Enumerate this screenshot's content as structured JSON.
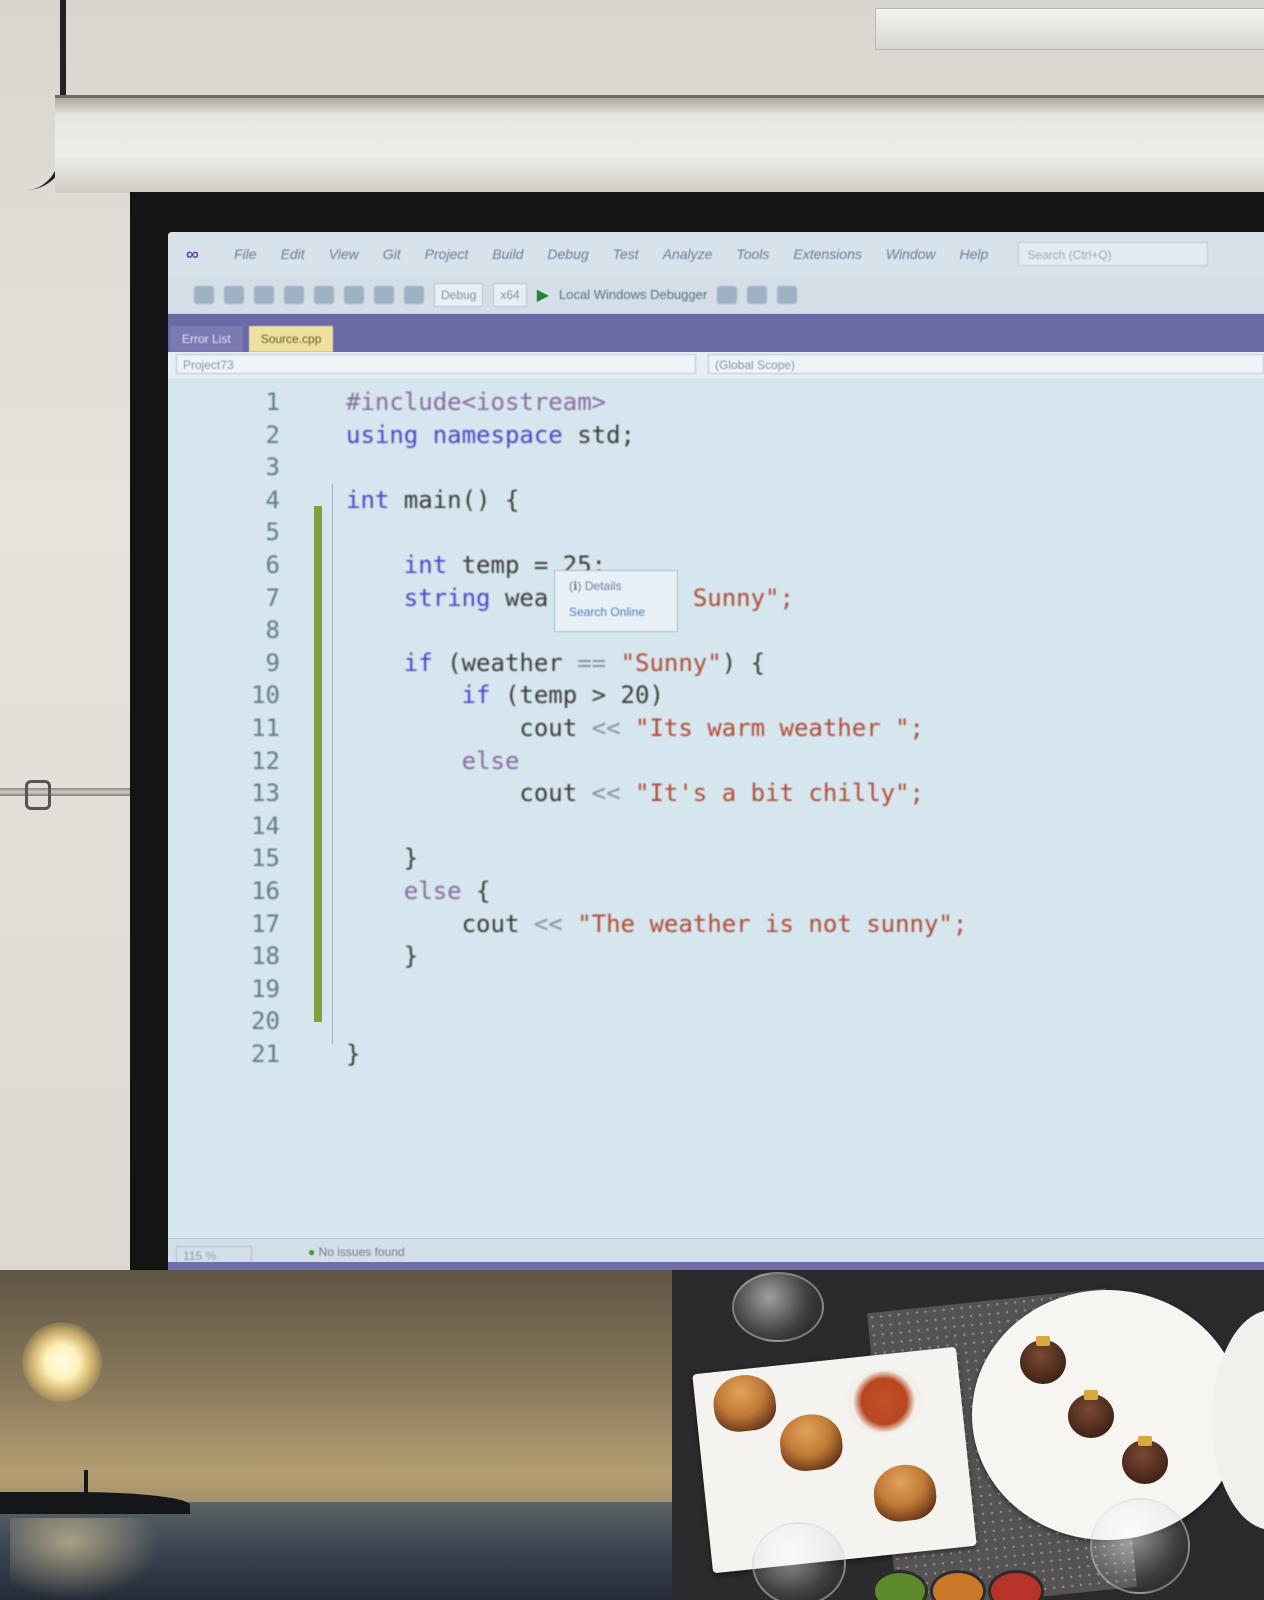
{
  "ide": {
    "menu": [
      "File",
      "Edit",
      "View",
      "Git",
      "Project",
      "Build",
      "Debug",
      "Test",
      "Analyze",
      "Tools",
      "Extensions",
      "Window",
      "Help"
    ],
    "search_placeholder": "Search (Ctrl+Q)",
    "toolbar": {
      "config": "Debug",
      "platform": "x64",
      "debugger": "Local Windows Debugger"
    },
    "tabs": {
      "inactive": "Error List",
      "active": "Source.cpp"
    },
    "nav": {
      "project": "Project73",
      "scope": "(Global Scope)"
    },
    "code_lines": [
      {
        "n": "1",
        "parts": [
          {
            "t": "#include<iostream>",
            "c": "pre"
          }
        ]
      },
      {
        "n": "2",
        "parts": [
          {
            "t": "using namespace ",
            "c": "kw"
          },
          {
            "t": "std;",
            "c": "plain"
          }
        ]
      },
      {
        "n": "3",
        "parts": []
      },
      {
        "n": "4",
        "parts": [
          {
            "t": "int ",
            "c": "kw"
          },
          {
            "t": "main() {",
            "c": "plain"
          }
        ]
      },
      {
        "n": "5",
        "parts": []
      },
      {
        "n": "6",
        "parts": [
          {
            "t": "    int ",
            "c": "kw"
          },
          {
            "t": "temp = 25;",
            "c": "plain"
          }
        ]
      },
      {
        "n": "7",
        "parts": [
          {
            "t": "    string ",
            "c": "kw"
          },
          {
            "t": "wea",
            "c": "plain"
          },
          {
            "t": "          ",
            "c": "plain"
          },
          {
            "t": "Sunny\";",
            "c": "str"
          }
        ]
      },
      {
        "n": "8",
        "parts": []
      },
      {
        "n": "9",
        "parts": [
          {
            "t": "    if ",
            "c": "kw"
          },
          {
            "t": "(weather ",
            "c": "plain"
          },
          {
            "t": "== ",
            "c": "op"
          },
          {
            "t": "\"Sunny\"",
            "c": "str"
          },
          {
            "t": ") {",
            "c": "plain"
          }
        ]
      },
      {
        "n": "10",
        "parts": [
          {
            "t": "        if ",
            "c": "kw"
          },
          {
            "t": "(temp > 20)",
            "c": "plain"
          }
        ]
      },
      {
        "n": "11",
        "parts": [
          {
            "t": "            cout ",
            "c": "plain"
          },
          {
            "t": "<< ",
            "c": "op"
          },
          {
            "t": "\"Its warm weather \";",
            "c": "str"
          }
        ]
      },
      {
        "n": "12",
        "parts": [
          {
            "t": "        else",
            "c": "pre"
          }
        ]
      },
      {
        "n": "13",
        "parts": [
          {
            "t": "            cout ",
            "c": "plain"
          },
          {
            "t": "<< ",
            "c": "op"
          },
          {
            "t": "\"It's a bit chilly\";",
            "c": "str"
          }
        ]
      },
      {
        "n": "14",
        "parts": []
      },
      {
        "n": "15",
        "parts": [
          {
            "t": "    }",
            "c": "plain"
          }
        ]
      },
      {
        "n": "16",
        "parts": [
          {
            "t": "    else ",
            "c": "pre"
          },
          {
            "t": "{",
            "c": "plain"
          }
        ]
      },
      {
        "n": "17",
        "parts": [
          {
            "t": "        cout ",
            "c": "plain"
          },
          {
            "t": "<< ",
            "c": "op"
          },
          {
            "t": "\"The weather is not sunny\";",
            "c": "str"
          }
        ]
      },
      {
        "n": "18",
        "parts": [
          {
            "t": "    }",
            "c": "plain"
          }
        ]
      },
      {
        "n": "19",
        "parts": []
      },
      {
        "n": "20",
        "parts": []
      },
      {
        "n": "21",
        "parts": [
          {
            "t": "}",
            "c": "plain"
          }
        ]
      }
    ],
    "quickinfo": {
      "line1": "(ℹ) Details",
      "line2": "Search Online"
    },
    "status": {
      "zoom": "115 %",
      "message": "No issues found"
    }
  }
}
